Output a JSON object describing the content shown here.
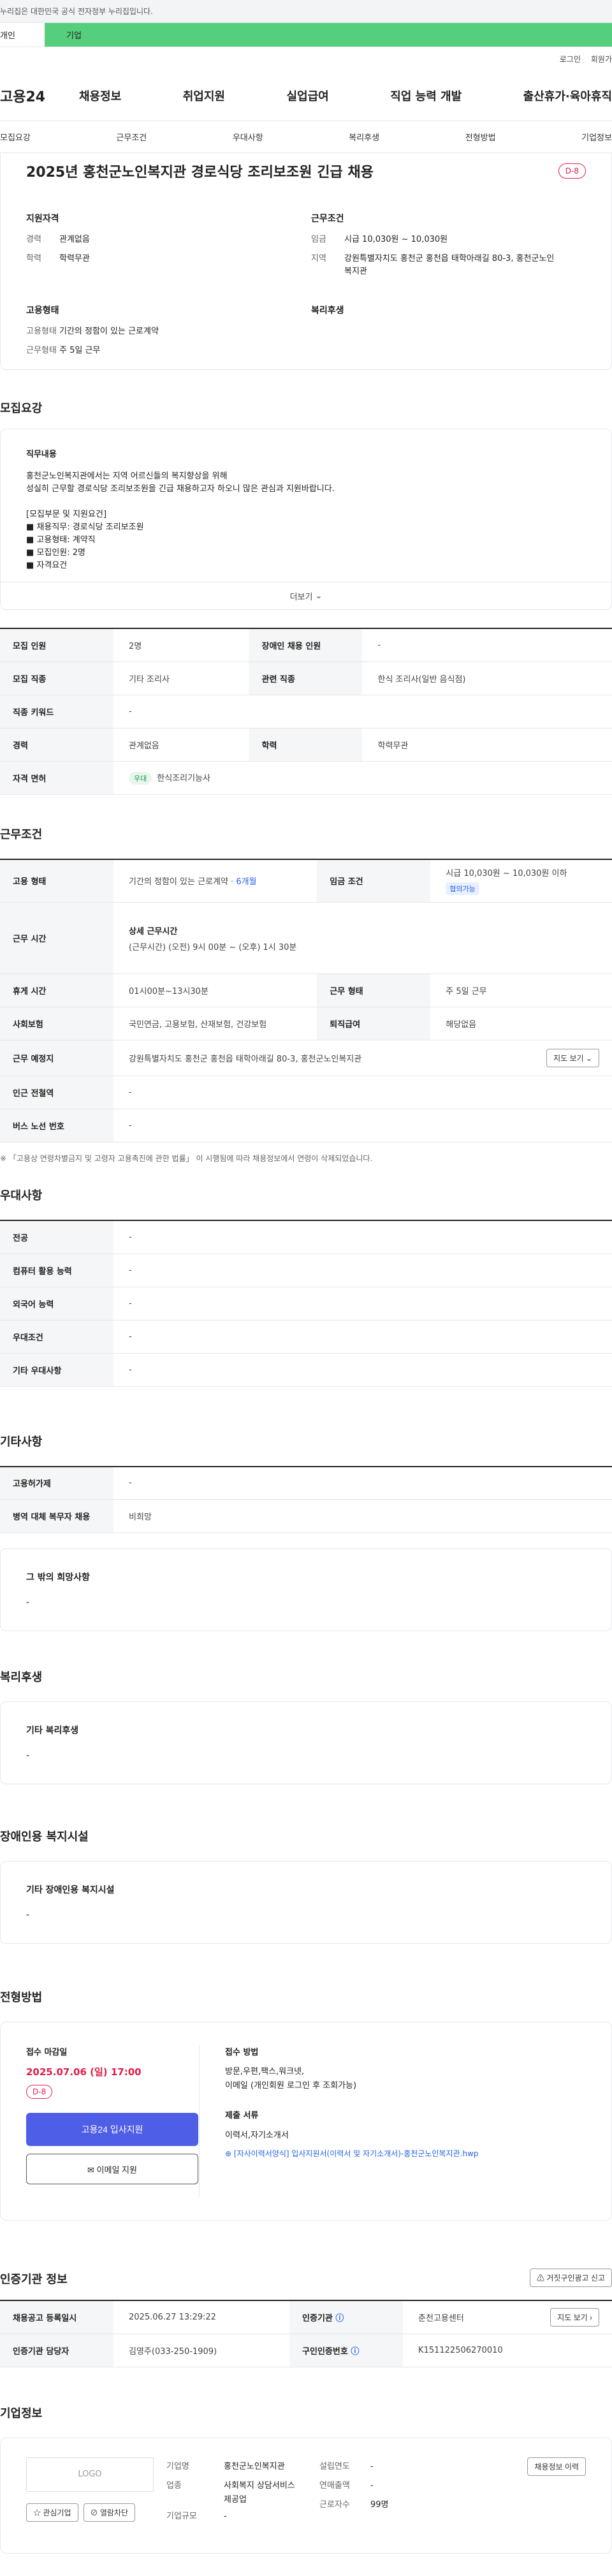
{
  "banner": {
    "text": "누리집은 대한민국 공식 전자정부 누리집입니다."
  },
  "tabs": {
    "personal": "개인",
    "enterprise": "기업"
  },
  "util": {
    "login": "로그인",
    "join": "회원가"
  },
  "gnb": {
    "logo": "고용24",
    "menu": [
      "채용정보",
      "취업지원",
      "실업급여",
      "직업 능력 개발",
      "출산휴가·육아휴직"
    ]
  },
  "subnav": [
    "모집요강",
    "근무조건",
    "우대사항",
    "복리후생",
    "전형방법",
    "기업정보"
  ],
  "summary": {
    "title": "2025년 홍천군노인복지관 경로식당 조리보조원 긴급 채용",
    "dday": "D-8",
    "qual": {
      "title": "지원자격",
      "rows": [
        {
          "k": "경력",
          "v": "관계없음"
        },
        {
          "k": "학력",
          "v": "학력무관"
        }
      ]
    },
    "cond": {
      "title": "근무조건",
      "rows": [
        {
          "k": "임금",
          "v": "시급 10,030원 ~ 10,030원"
        },
        {
          "k": "지역",
          "v": "강원특별자치도 홍천군 홍천읍 태학아래길 80-3, 홍천군노인복지관"
        }
      ]
    },
    "emp": {
      "title": "고용형태",
      "rows": [
        {
          "k": "고용형태",
          "v": "기간의 정함이 있는 근로계약"
        },
        {
          "k": "근무형태",
          "v": "주 5일 근무"
        }
      ]
    },
    "welfare": {
      "title": "복리후생"
    }
  },
  "recruit": {
    "title": "모집요강",
    "desc_title": "직무내용",
    "desc_lines": [
      "홍천군노인복지관에서는 지역 어르신들의 복지향상을 위해",
      "성실히 근무할 경로식당 조리보조원을 긴급 채용하고자 하오니 많은 관심과 지원바랍니다.",
      "",
      "[모집부문 및 지원요건]",
      "■ 채용직무: 경로식당 조리보조원",
      "■ 고용형태: 계약직",
      "■ 모집인원: 2명",
      "■ 자격요건"
    ],
    "more": "더보기",
    "rows": [
      [
        "모집 인원",
        "2명",
        "장애인 채용 인원",
        "-"
      ],
      [
        "모집 직종",
        "기타 조리사",
        "관련 직종",
        "한식 조리사(일반 음식점)"
      ],
      [
        "직종 키워드",
        "-"
      ],
      [
        "경력",
        "관계없음",
        "학력",
        "학력무관"
      ]
    ],
    "license_label": "자격 면허",
    "license_badge": "우대",
    "license": "한식조리기능사"
  },
  "work": {
    "title": "근무조건",
    "emp_label": "고용 형태",
    "emp": "기간의 정함이 있는 근로계약",
    "emp_period": " · 6개월",
    "wage_label": "임금 조건",
    "wage": "시급 10,030원 ~ 10,030원 이하",
    "wage_badge": "협의가능",
    "time_label": "근무 시간",
    "time_title": "상세 근무시간",
    "time": "(근무시간) (오전) 9시 00분 ~ (오후) 1시 30분",
    "rest_label": "휴게 시간",
    "rest": "01시00분~13시30분",
    "form_label": "근무 형태",
    "form": "주 5일 근무",
    "ins_label": "사회보험",
    "ins": "국민연금, 고용보험, 산재보험, 건강보험",
    "sev_label": "퇴직급여",
    "sev": "해당없음",
    "place_label": "근무 예정지",
    "place": "강원특별자치도 홍천군 홍천읍 태학아래길 80-3, 홍천군노인복지관",
    "map_btn": "지도 보기",
    "sub_label": "인근 전철역",
    "sub": "-",
    "bus_label": "버스 노선 번호",
    "bus": "-",
    "note": "※ 「고용상 연령차별금지 및 고령자 고용촉진에 관한 법률」 이 시행됨에 따라 채용정보에서 연령이 삭제되었습니다."
  },
  "pref": {
    "title": "우대사항",
    "rows": [
      [
        "전공",
        "-"
      ],
      [
        "컴퓨터 활용 능력",
        "-"
      ],
      [
        "외국어 능력",
        "-"
      ],
      [
        "우대조건",
        "-"
      ],
      [
        "기타 우대사항",
        "-"
      ]
    ]
  },
  "etc": {
    "title": "기타사항",
    "rows": [
      [
        "고용허가제",
        "-"
      ],
      [
        "병역 대체 복무자 채용",
        "비희망"
      ]
    ],
    "wish_title": "그 밖의 희망사항",
    "wish": "-"
  },
  "welfare": {
    "title": "복리후생",
    "box_title": "기타 복리후생",
    "box": "-"
  },
  "disabled": {
    "title": "장애인용 복지시설",
    "box_title": "기타 장애인용 복지시설",
    "box": "-"
  },
  "process": {
    "title": "전형방법",
    "deadline_label": "접수 마감일",
    "deadline": "2025.07.06 (일) 17:00",
    "dday": "D-8",
    "apply_btn": "고용24 입사지원",
    "email_btn": "이메일 지원",
    "method_label": "접수 방법",
    "method": "방문,우편,팩스,워크넷,",
    "method2": "이메일 (개인회원 로그인 후 조회가능)",
    "docs_label": "제출 서류",
    "docs": "이력서,자기소개서",
    "file": "[자사이력서양식] 입사지원서(이력서 및 자기소개서)-홍천군노인복지관.hwp"
  },
  "agency": {
    "title": "인증기관 정보",
    "report_btn": "거짓구인광고 신고",
    "reg_label": "채용공고 등록일시",
    "reg": "2025.06.27 13:29:22",
    "org_label": "인증기관",
    "org": "춘천고용센터",
    "map_btn": "지도 보기",
    "mgr_label": "인증기관 담당자",
    "mgr": "김영주(033-250-1909)",
    "no_label": "구인인증번호",
    "no": "K151122506270010"
  },
  "company": {
    "title": "기업정보",
    "logo": "LOGO",
    "fav": "관심기업",
    "block": "열람차단",
    "name_label": "기업명",
    "name": "홍천군노인복지관",
    "biz_label": "업종",
    "biz": "사회복지 상담서비스 제공업",
    "scale_label": "기업규모",
    "scale": "-",
    "est_label": "설립연도",
    "est": "-",
    "sales_label": "연매출액",
    "sales": "-",
    "staff_label": "근로자수",
    "staff": "99명",
    "jobs_btn": "채용정보 이력"
  }
}
